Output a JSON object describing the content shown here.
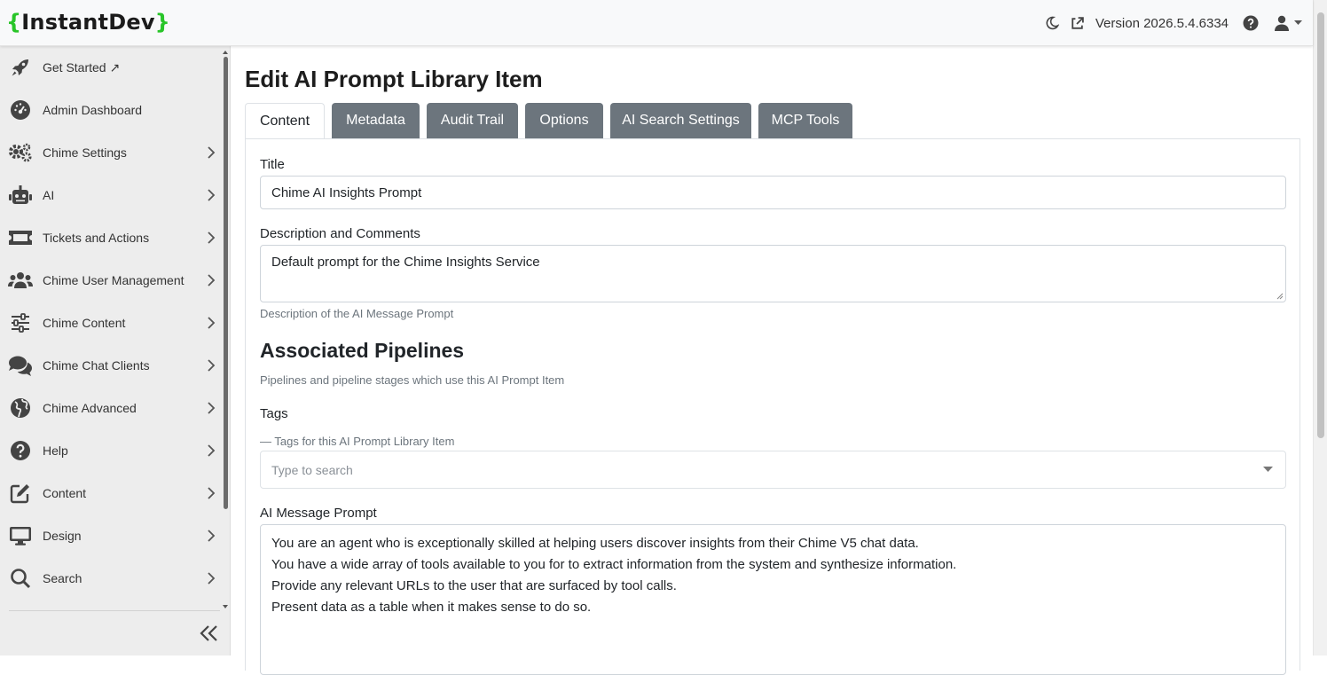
{
  "brand": {
    "open": "{",
    "name": "InstantDev",
    "close": "}"
  },
  "topbar": {
    "version": "Version 2026.5.4.6334"
  },
  "sidebar": {
    "items": [
      {
        "label": "Get Started ↗",
        "icon": "rocket-icon",
        "chevron": false
      },
      {
        "label": "Admin Dashboard",
        "icon": "dashboard-gauge-icon",
        "chevron": false
      },
      {
        "label": "Chime Settings",
        "icon": "gears-icon",
        "chevron": true
      },
      {
        "label": "AI",
        "icon": "robot-icon",
        "chevron": true
      },
      {
        "label": "Tickets and Actions",
        "icon": "ticket-icon",
        "chevron": true
      },
      {
        "label": "Chime User Management",
        "icon": "users-icon",
        "chevron": true
      },
      {
        "label": "Chime Content",
        "icon": "sliders-icon",
        "chevron": true
      },
      {
        "label": "Chime Chat Clients",
        "icon": "comments-icon",
        "chevron": true
      },
      {
        "label": "Chime Advanced",
        "icon": "globe-icon",
        "chevron": true
      },
      {
        "label": "Help",
        "icon": "question-circle-icon",
        "chevron": true
      },
      {
        "label": "Content",
        "icon": "edit-icon",
        "chevron": true
      },
      {
        "label": "Design",
        "icon": "desktop-icon",
        "chevron": true
      },
      {
        "label": "Search",
        "icon": "search-icon",
        "chevron": true
      }
    ]
  },
  "page": {
    "title": "Edit AI Prompt Library Item",
    "tabs": [
      {
        "label": "Content",
        "active": true
      },
      {
        "label": "Metadata",
        "active": false
      },
      {
        "label": "Audit Trail",
        "active": false
      },
      {
        "label": "Options",
        "active": false
      },
      {
        "label": "AI Search Settings",
        "active": false
      },
      {
        "label": "MCP Tools",
        "active": false
      }
    ]
  },
  "form": {
    "title_label": "Title",
    "title_value": "Chime AI Insights Prompt",
    "description_label": "Description and Comments",
    "description_value": "Default prompt for the Chime Insights Service",
    "description_help": "Description of the AI Message Prompt",
    "pipelines_heading": "Associated Pipelines",
    "pipelines_help": "Pipelines and pipeline stages which use this AI Prompt Item",
    "tags_label": "Tags",
    "tags_help": "— Tags for this AI Prompt Library Item",
    "tags_placeholder": "Type to search",
    "prompt_label": "AI Message Prompt",
    "prompt_lines": [
      "You are an agent who is exceptionally skilled at helping users discover insights from their Chime V5 chat data.",
      "You have a wide array of tools available to you for to extract information from the system and synthesize information.",
      "Provide any relevant URLs to the user that are surfaced by tool calls.",
      "Present data as a table when it makes sense to do so."
    ]
  },
  "colors": {
    "brand_brace": "#29c529",
    "tab_inactive": "#6c757d",
    "sidebar_bg": "#ededed"
  }
}
